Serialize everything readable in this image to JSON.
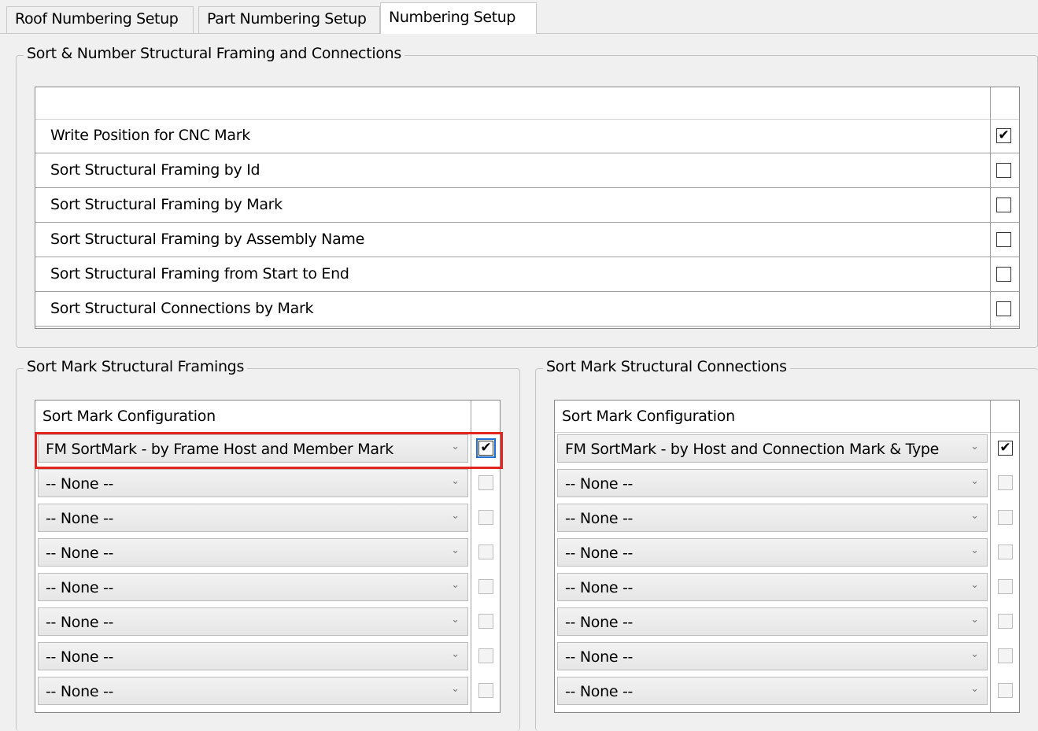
{
  "tabs": [
    {
      "label": "Roof Numbering Setup",
      "active": false
    },
    {
      "label": "Part Numbering Setup",
      "active": false
    },
    {
      "label": "Numbering Setup",
      "active": true
    }
  ],
  "sort_number_group": {
    "title": "Sort & Number Structural Framing and Connections",
    "options": [
      {
        "label": "Write Position for CNC Mark",
        "checked": true
      },
      {
        "label": "Sort Structural Framing by Id",
        "checked": false
      },
      {
        "label": "Sort Structural Framing by Mark",
        "checked": false
      },
      {
        "label": "Sort Structural Framing by Assembly Name",
        "checked": false
      },
      {
        "label": "Sort Structural Framing from Start to End",
        "checked": false
      },
      {
        "label": "Sort Structural Connections by Mark",
        "checked": false
      }
    ]
  },
  "framings_group": {
    "title": "Sort Mark Structural Framings",
    "column_header": "Sort Mark Configuration",
    "rows": [
      {
        "value": "FM SortMark - by Frame Host and Member Mark",
        "checked": true
      },
      {
        "value": "-- None --",
        "checked": false
      },
      {
        "value": "-- None --",
        "checked": false
      },
      {
        "value": "-- None --",
        "checked": false
      },
      {
        "value": "-- None --",
        "checked": false
      },
      {
        "value": "-- None --",
        "checked": false
      },
      {
        "value": "-- None --",
        "checked": false
      },
      {
        "value": "-- None --",
        "checked": false
      }
    ]
  },
  "connections_group": {
    "title": "Sort Mark Structural Connections",
    "column_header": "Sort Mark Configuration",
    "rows": [
      {
        "value": "FM SortMark - by Host and Connection Mark & Type",
        "checked": true
      },
      {
        "value": "-- None --",
        "checked": false
      },
      {
        "value": "-- None --",
        "checked": false
      },
      {
        "value": "-- None --",
        "checked": false
      },
      {
        "value": "-- None --",
        "checked": false
      },
      {
        "value": "-- None --",
        "checked": false
      },
      {
        "value": "-- None --",
        "checked": false
      },
      {
        "value": "-- None --",
        "checked": false
      }
    ]
  },
  "icons": {
    "checkmark": "✔",
    "dropdown": "⌄"
  },
  "colors": {
    "highlight": "#e3241f",
    "focus": "#1e6ed6"
  }
}
